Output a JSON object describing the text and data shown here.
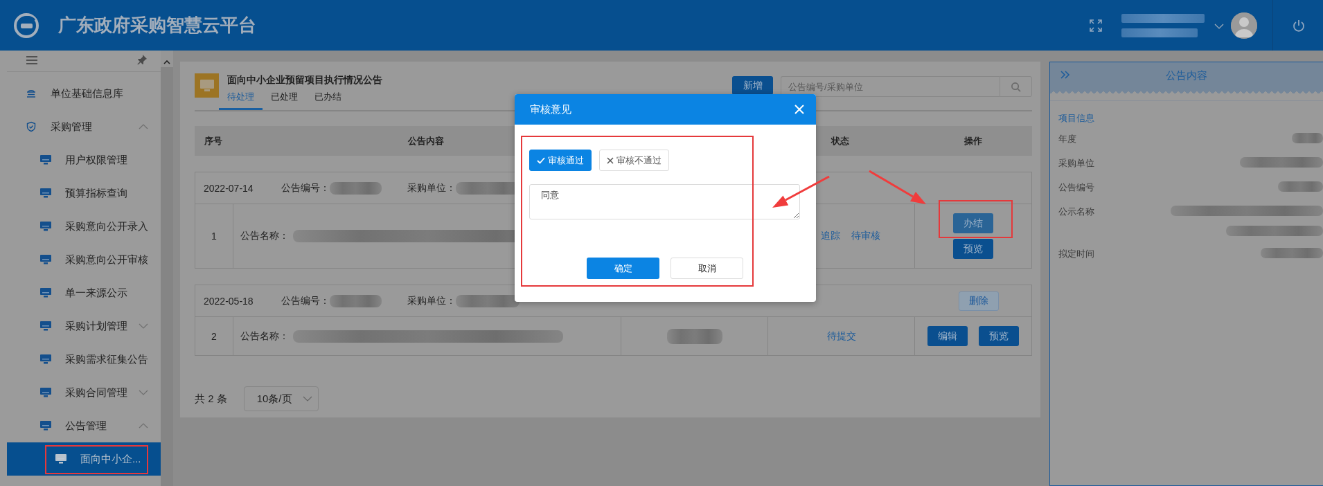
{
  "header": {
    "title": "广东政府采购智慧云平台"
  },
  "sidebar": {
    "items": [
      {
        "label": "单位基础信息库",
        "selected": false
      },
      {
        "label": "采购管理",
        "selected": false,
        "expanded": true,
        "children": [
          {
            "label": "用户权限管理",
            "selected": false
          },
          {
            "label": "预算指标查询",
            "selected": false
          },
          {
            "label": "采购意向公开录入",
            "selected": false
          },
          {
            "label": "采购意向公开审核",
            "selected": false
          },
          {
            "label": "单一来源公示",
            "selected": false
          },
          {
            "label": "采购计划管理",
            "selected": false,
            "expanded": false
          },
          {
            "label": "采购需求征集公告",
            "selected": false
          },
          {
            "label": "采购合同管理",
            "selected": false,
            "expanded": false
          },
          {
            "label": "公告管理",
            "selected": false,
            "expanded": true,
            "children": [
              {
                "label": "面向中小企...",
                "selected": true,
                "highlighted": true
              }
            ]
          }
        ]
      }
    ]
  },
  "page": {
    "title": "面向中小企业预留项目执行情况公告",
    "tabs": [
      {
        "label": "待处理",
        "selected": true
      },
      {
        "label": "已处理",
        "selected": false
      },
      {
        "label": "已办结",
        "selected": false
      }
    ],
    "add_button": "新增",
    "search": {
      "placeholder": "公告编号/采购单位"
    }
  },
  "table": {
    "columns": [
      "序号",
      "公告内容",
      "状态",
      "操作"
    ],
    "groups": [
      {
        "date": "2022-07-14",
        "number_label": "公告编号：",
        "unit_label": "采购单位：",
        "index": "1",
        "name_label": "公告名称：",
        "links": [
          "追踪"
        ],
        "status": "待审核",
        "kind": "stacked",
        "actions": [
          {
            "label": "办结",
            "highlighted": true
          },
          {
            "label": "预览",
            "highlighted": false
          }
        ]
      },
      {
        "date": "2022-05-18",
        "number_label": "公告编号：",
        "unit_label": "采购单位：",
        "date_actions": [
          "删除"
        ],
        "index": "2",
        "name_label": "公告名称：",
        "status": "待提交",
        "kind": "inline",
        "actions": [
          {
            "label": "编辑",
            "highlighted": false
          },
          {
            "label": "预览",
            "highlighted": false
          }
        ]
      }
    ]
  },
  "pagination": {
    "total": "共 2 条",
    "page_size": "10条/页"
  },
  "info_panel": {
    "title": "公告内容",
    "section": "项目信息",
    "fields": [
      "年度",
      "采购单位",
      "公告编号",
      "公示名称",
      "拟定时间"
    ]
  },
  "dialog": {
    "title": "审核意见",
    "highlighted": true,
    "options": [
      {
        "label": "审核通过",
        "selected": true
      },
      {
        "label": "审核不通过",
        "selected": false
      }
    ],
    "comment": "同意",
    "buttons": [
      {
        "label": "确定",
        "kind": "primary"
      },
      {
        "label": "取消",
        "kind": "default"
      }
    ]
  }
}
